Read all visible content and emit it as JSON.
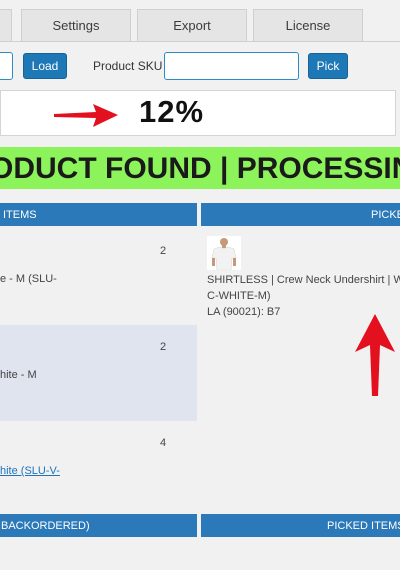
{
  "tabs": [
    {
      "label": ""
    },
    {
      "label": "Settings"
    },
    {
      "label": "Export"
    },
    {
      "label": "License"
    }
  ],
  "toolbar": {
    "load_label": "Load",
    "sku_label": "Product SKU",
    "sku_value": "",
    "pick_label": "Pick"
  },
  "progress": {
    "percent_text": "12%",
    "value": 12
  },
  "status": {
    "text": "ODUCT FOUND | PROCESSING"
  },
  "left_panel": {
    "header": " ITEMS",
    "rows": [
      {
        "qty": "2",
        "line1": "e - M (SLU-",
        "line2": ""
      },
      {
        "qty": "2",
        "line1": "hite - M",
        "line2": ""
      },
      {
        "qty": "4",
        "line1": "hite (SLU-V-",
        "line2": ""
      }
    ],
    "footer_header": "BACKORDERED)"
  },
  "right_panel": {
    "header": "PICKED",
    "item": {
      "line1": "SHIRTLESS | Crew Neck Undershirt | W",
      "line2": "C-WHITE-M)",
      "line3": "LA (90021): B7"
    },
    "footer_header": "PICKED ITEMS"
  },
  "colors": {
    "accent": "#2b79b8",
    "button": "#1e78b5",
    "status_bg": "#8cf45a",
    "arrow": "#e3101f"
  }
}
